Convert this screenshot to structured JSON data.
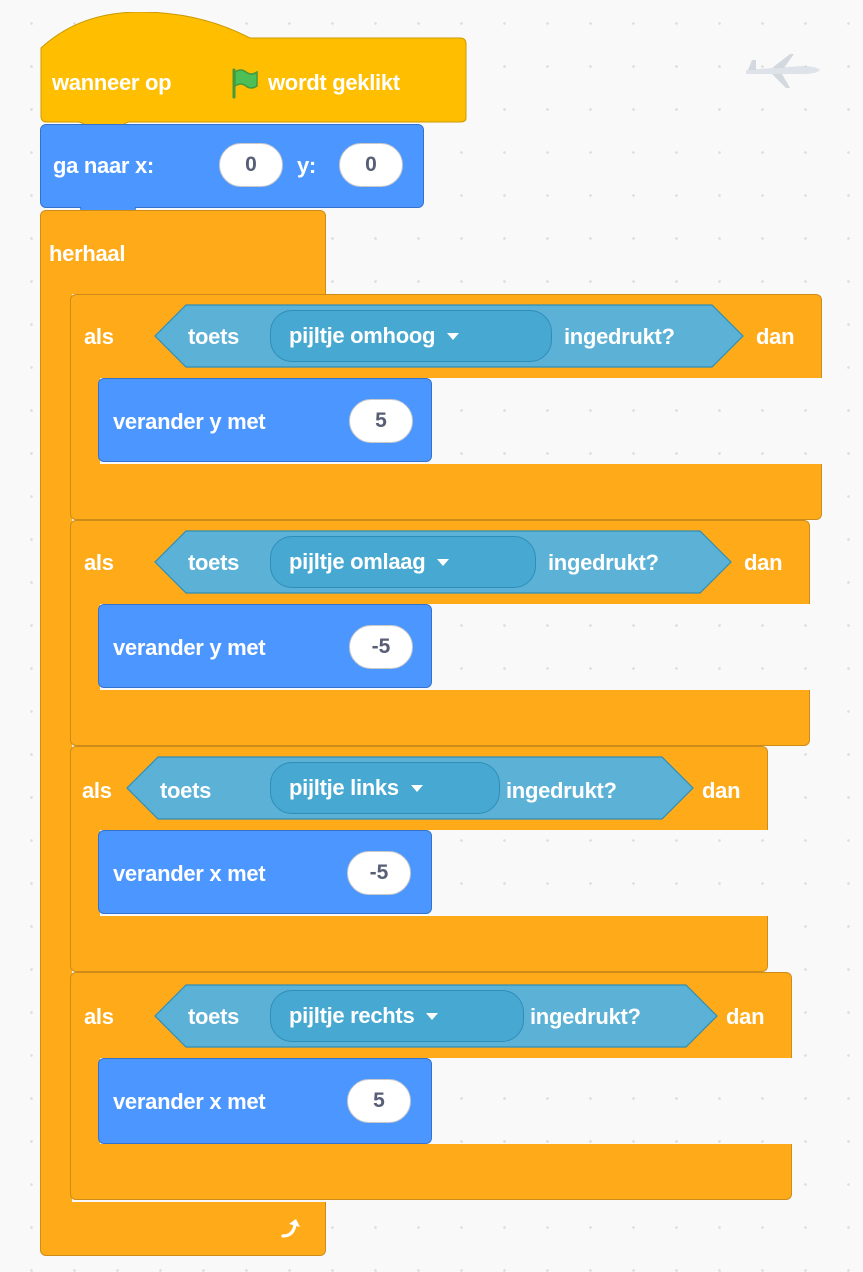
{
  "event_block": {
    "label_before": "wanneer op",
    "flag_icon": "green-flag-icon",
    "label_after": "wordt geklikt"
  },
  "goto_block": {
    "label_x": "ga naar x:",
    "x_value": "0",
    "label_y": "y:",
    "y_value": "0"
  },
  "forever_block": {
    "label": "herhaal",
    "loop_icon": "loop-arrow-icon"
  },
  "if_blocks": [
    {
      "label_if": "als",
      "label_key": "toets",
      "key": "pijltje omhoog",
      "label_pressed": "ingedrukt?",
      "label_then": "dan",
      "action_label": "verander y met",
      "action_value": "5"
    },
    {
      "label_if": "als",
      "label_key": "toets",
      "key": "pijltje omlaag",
      "label_pressed": "ingedrukt?",
      "label_then": "dan",
      "action_label": "verander y met",
      "action_value": "-5"
    },
    {
      "label_if": "als",
      "label_key": "toets",
      "key": "pijltje links",
      "label_pressed": "ingedrukt?",
      "label_then": "dan",
      "action_label": "verander x met",
      "action_value": "-5"
    },
    {
      "label_if": "als",
      "label_key": "toets",
      "key": "pijltje rechts",
      "label_pressed": "ingedrukt?",
      "label_then": "dan",
      "action_label": "verander x met",
      "action_value": "5"
    }
  ],
  "colors": {
    "events": "#FFBF00",
    "control": "#FFAB19",
    "motion": "#4C97FF",
    "sensing": "#5CB1D6",
    "flag": "#4CBF56"
  },
  "background_icon": "airplane-sprite-icon"
}
